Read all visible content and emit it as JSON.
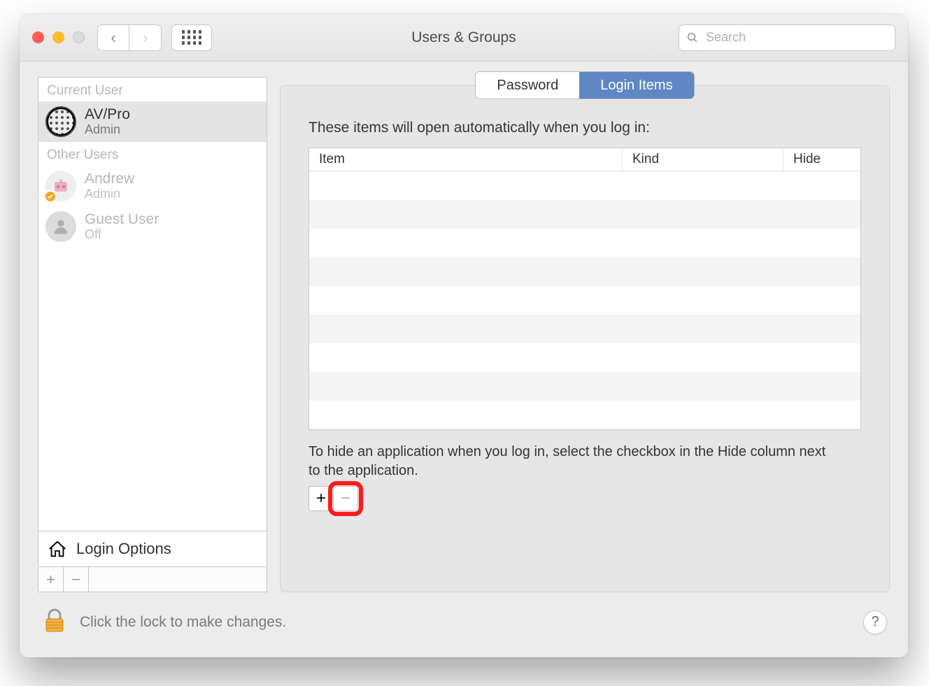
{
  "window": {
    "title": "Users & Groups"
  },
  "search": {
    "placeholder": "Search"
  },
  "sidebar": {
    "section_current": "Current User",
    "section_other": "Other Users",
    "users": [
      {
        "name": "AV/Pro",
        "role": "Admin"
      },
      {
        "name": "Andrew",
        "role": "Admin"
      },
      {
        "name": "Guest User",
        "role": "Off"
      }
    ],
    "login_options": "Login Options"
  },
  "tabs": {
    "password": "Password",
    "login_items": "Login Items"
  },
  "main": {
    "intro": "These items will open automatically when you log in:",
    "cols": {
      "item": "Item",
      "kind": "Kind",
      "hide": "Hide"
    },
    "hint": "To hide an application when you log in, select the checkbox in the Hide column next to the application."
  },
  "footer": {
    "lock_text": "Click the lock to make changes.",
    "help": "?"
  },
  "icons": {
    "plus": "+",
    "minus": "−",
    "chev_left": "‹",
    "chev_right": "›"
  }
}
